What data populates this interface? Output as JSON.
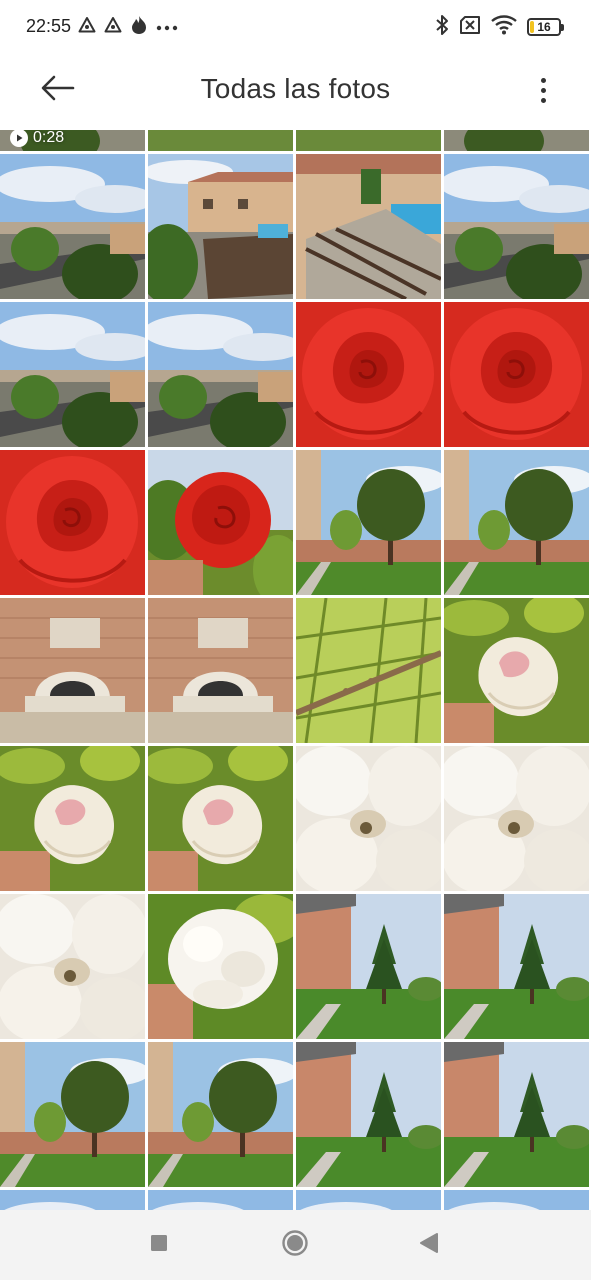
{
  "status_bar": {
    "time": "22:55",
    "left_icons": [
      "alert-triangle-icon",
      "alert-triangle-icon",
      "flame-icon",
      "more-horizontal-icon"
    ],
    "right_icons": [
      "bluetooth-icon",
      "sim-off-icon",
      "wifi-icon",
      "battery-icon"
    ],
    "battery_level": "16",
    "battery_fraction": 0.16,
    "battery_color": "#f2c320"
  },
  "app_bar": {
    "title": "Todas las fotos",
    "back_icon": "arrow-left-icon",
    "menu_icon": "more-vertical-icon"
  },
  "gallery": {
    "video_duration": "0:28",
    "thumbnails": [
      {
        "subject": "street-view",
        "video": true
      },
      {
        "subject": "lawn"
      },
      {
        "subject": "lawn"
      },
      {
        "subject": "street-view"
      },
      {
        "subject": "sky-street-trees"
      },
      {
        "subject": "house-rooftops"
      },
      {
        "subject": "house-pool-pergola"
      },
      {
        "subject": "sky-street-trees"
      },
      {
        "subject": "sky-street-trees"
      },
      {
        "subject": "sky-street-trees"
      },
      {
        "subject": "red-rose"
      },
      {
        "subject": "red-rose"
      },
      {
        "subject": "red-rose"
      },
      {
        "subject": "red-rose-leaves"
      },
      {
        "subject": "garden-tree"
      },
      {
        "subject": "garden-tree"
      },
      {
        "subject": "brick-oven"
      },
      {
        "subject": "brick-oven"
      },
      {
        "subject": "pine-branch"
      },
      {
        "subject": "white-rose-bud"
      },
      {
        "subject": "white-rose-bud"
      },
      {
        "subject": "white-rose-bud"
      },
      {
        "subject": "white-flower"
      },
      {
        "subject": "white-flower"
      },
      {
        "subject": "white-flower"
      },
      {
        "subject": "white-flower-hand"
      },
      {
        "subject": "fir-tree-garden"
      },
      {
        "subject": "fir-tree-garden"
      },
      {
        "subject": "garden-tree"
      },
      {
        "subject": "garden-tree"
      },
      {
        "subject": "fir-tree-garden"
      },
      {
        "subject": "fir-tree-garden"
      },
      {
        "subject": "sky-street-trees"
      },
      {
        "subject": "sky-street-trees"
      },
      {
        "subject": "sky-street-trees"
      },
      {
        "subject": "sky-street-trees"
      }
    ]
  },
  "nav_bar": {
    "icons": [
      "recents-square-icon",
      "home-circle-icon",
      "back-triangle-icon"
    ]
  }
}
